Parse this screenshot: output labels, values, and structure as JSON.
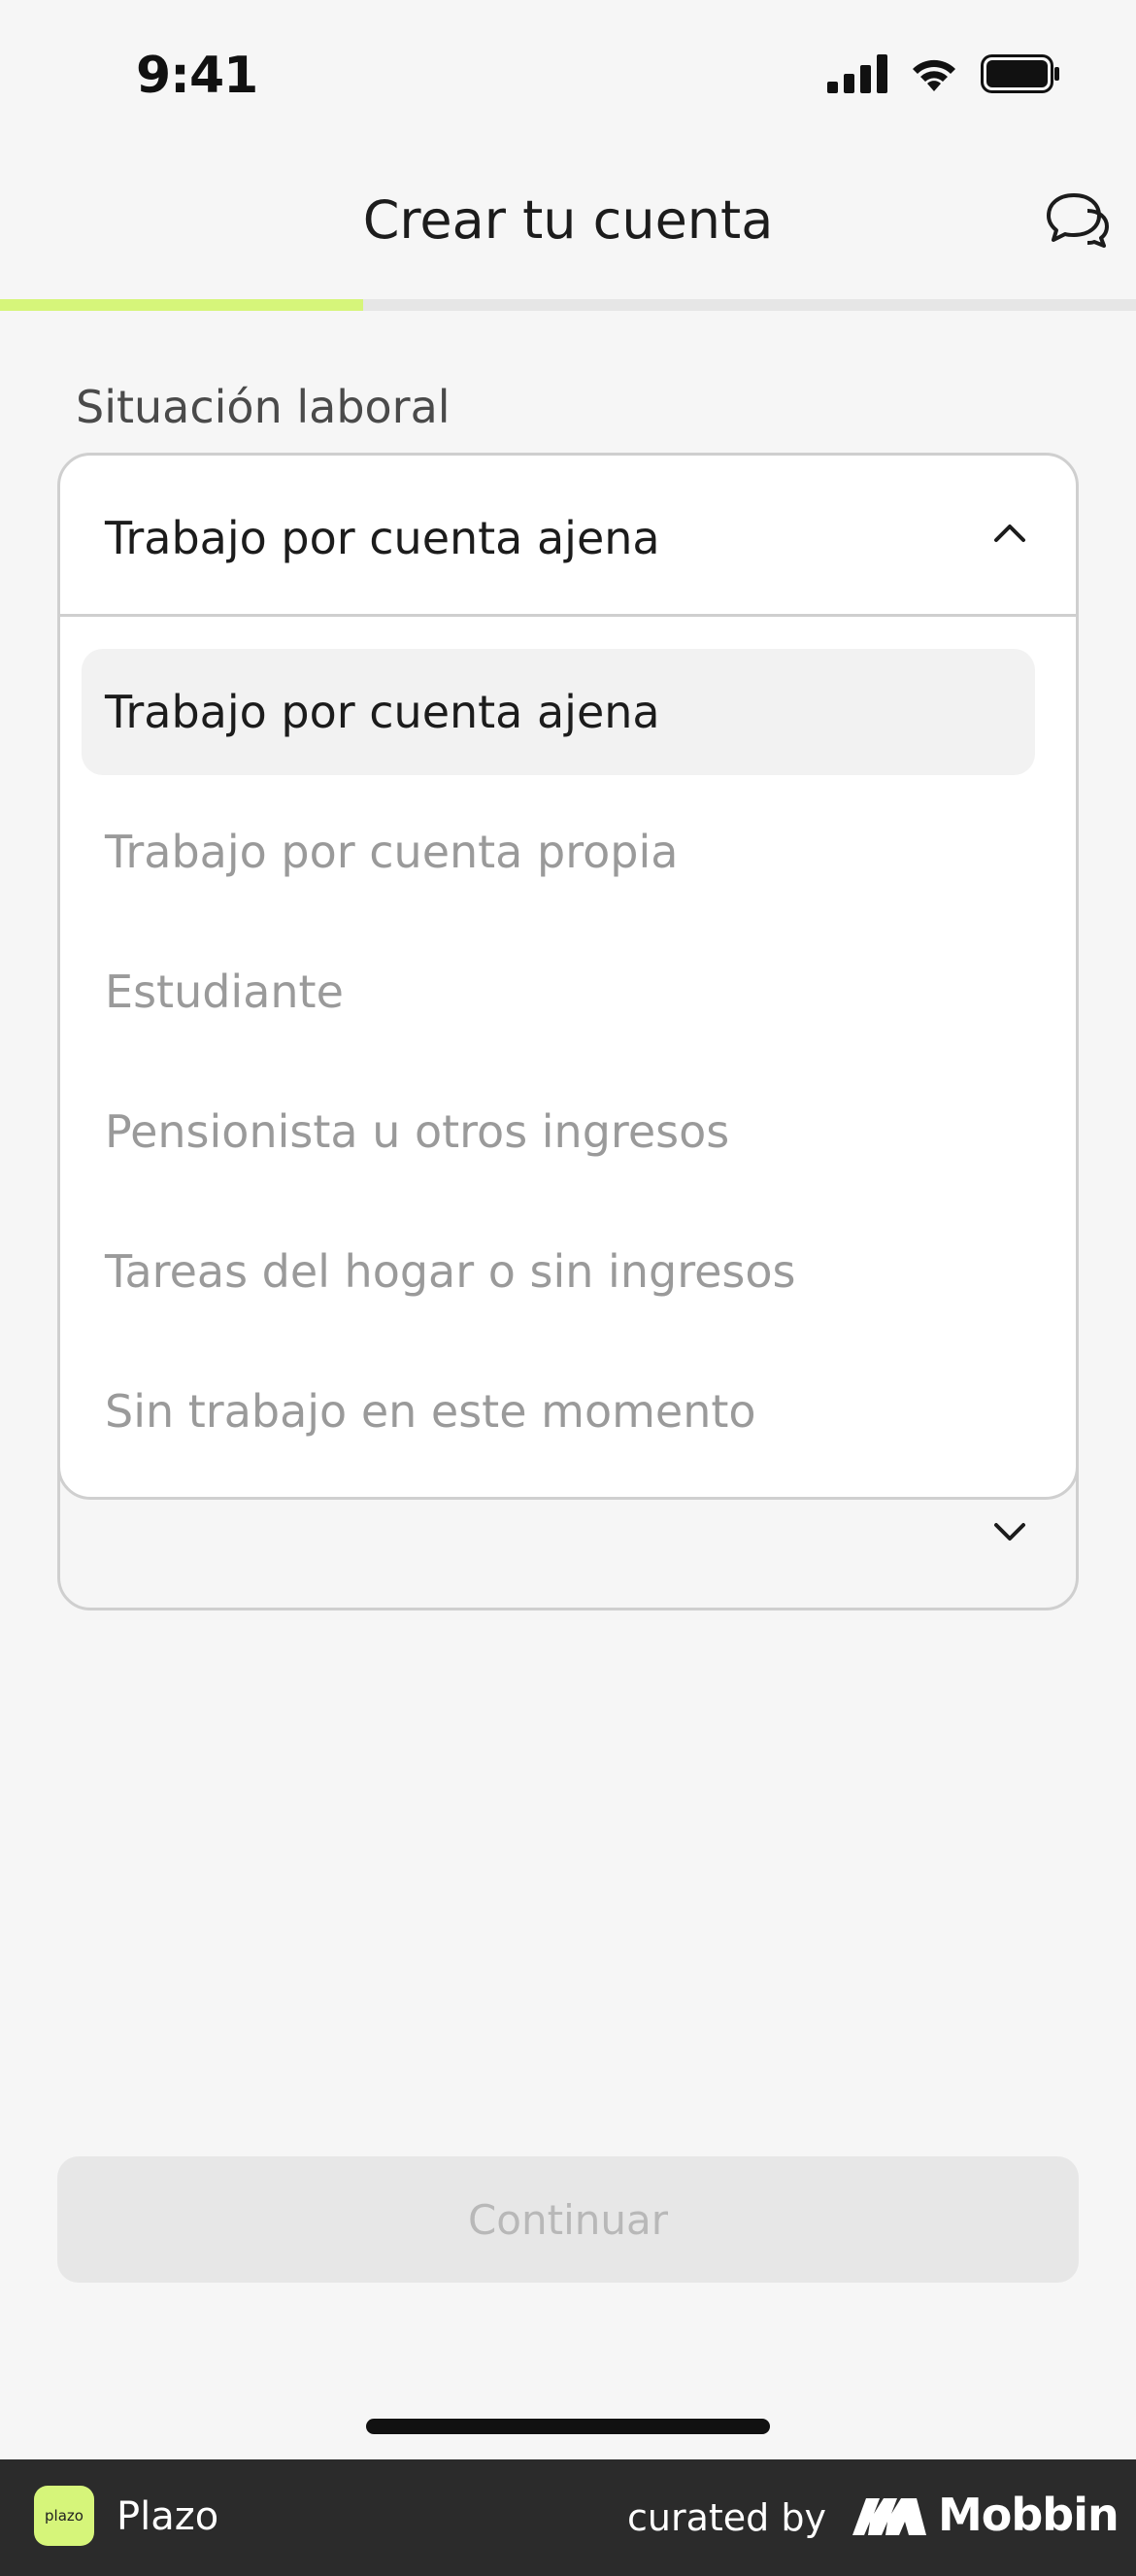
{
  "status_bar": {
    "time": "9:41",
    "icons": [
      "signal-icon",
      "wifi-icon",
      "battery-icon"
    ]
  },
  "nav": {
    "title": "Crear tu cuenta",
    "chat_icon": "chat-bubbles-icon"
  },
  "progress": {
    "fraction": 0.32,
    "color": "#d6f57a"
  },
  "form": {
    "label": "Situación laboral",
    "dropdown": {
      "selected_value": "Trabajo por cuenta ajena",
      "expanded": true,
      "options": [
        {
          "label": "Trabajo por cuenta ajena",
          "selected": true
        },
        {
          "label": "Trabajo por cuenta propia",
          "selected": false
        },
        {
          "label": "Estudiante",
          "selected": false
        },
        {
          "label": "Pensionista u otros ingresos",
          "selected": false
        },
        {
          "label": "Tareas del hogar o sin ingresos",
          "selected": false
        },
        {
          "label": "Sin trabajo en este momento",
          "selected": false
        }
      ]
    }
  },
  "actions": {
    "continue_label": "Continuar",
    "continue_enabled": false
  },
  "footer": {
    "app_logo_text": "plazo",
    "app_name": "Plazo",
    "curated_by": "curated by",
    "brand": "Mobbin"
  },
  "colors": {
    "accent": "#d6f57a",
    "background": "#f6f6f6",
    "footer": "#2b2b2b"
  }
}
